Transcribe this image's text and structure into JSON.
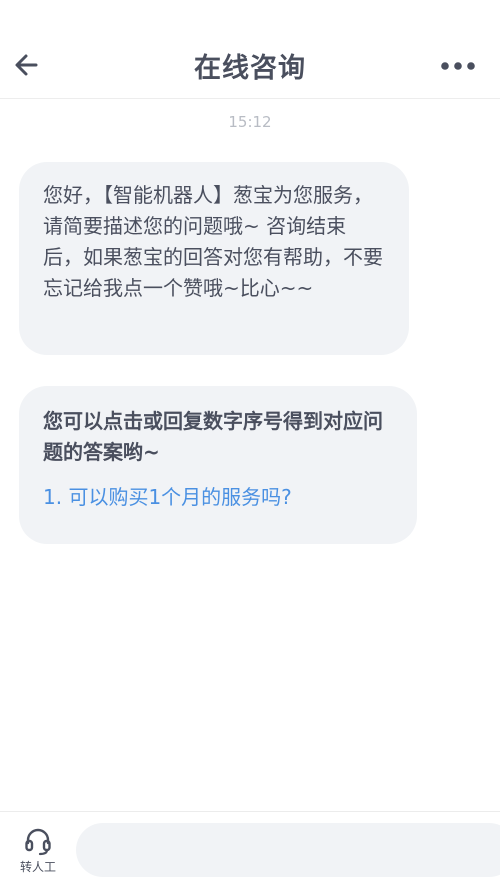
{
  "header": {
    "title": "在线咨询",
    "back_icon": "arrow-left-icon",
    "more_icon": "more-horizontal-icon"
  },
  "chat": {
    "timestamp": "15:12",
    "messages": [
      {
        "text": "您好，【智能机器人】葱宝为您服务，请简要描述您的问题哦~ 咨询结束后，如果葱宝的回答对您有帮助，不要忘记给我点一个赞哦~比心~~"
      },
      {
        "lead": "您可以点击或回复数字序号得到对应问题的答案哟~",
        "options": [
          {
            "label": "1. 可以购买1个月的服务吗?"
          }
        ]
      }
    ]
  },
  "footer": {
    "agent_icon": "headset-icon",
    "agent_label": "转人工",
    "input_value": "",
    "input_placeholder": ""
  },
  "colors": {
    "text": "#4a4f5e",
    "bubble": "#f1f3f6",
    "link": "#4a90e2",
    "timestamp": "#b8bcc4"
  }
}
